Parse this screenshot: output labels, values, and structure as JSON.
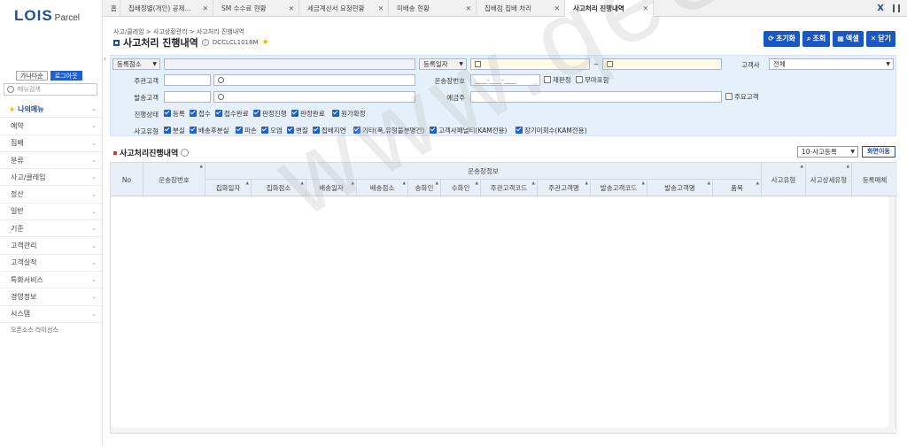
{
  "logo": {
    "brand": "LOIS",
    "sub": "Parcel"
  },
  "user": {
    "name_btn": "가나다순",
    "logout_btn": "로그아웃"
  },
  "menu_search": {
    "placeholder": "메뉴검색"
  },
  "menu": [
    {
      "label": "나의메뉴",
      "fav": true
    },
    {
      "label": "예약"
    },
    {
      "label": "집배"
    },
    {
      "label": "분류"
    },
    {
      "label": "사고/클레임"
    },
    {
      "label": "정산"
    },
    {
      "label": "일반"
    },
    {
      "label": "기준"
    },
    {
      "label": "고객관리"
    },
    {
      "label": "고객실적"
    },
    {
      "label": "특화서비스"
    },
    {
      "label": "경영정보"
    },
    {
      "label": "시스템"
    }
  ],
  "oss_label": "오픈소스 라이선스",
  "tabs": [
    {
      "label": "홈"
    },
    {
      "label": "집배정별(개인) 공제..."
    },
    {
      "label": "SM 수수료 현황"
    },
    {
      "label": "세금계산서 요청현황"
    },
    {
      "label": "미배송 현황"
    },
    {
      "label": "집배점 집배 처리"
    },
    {
      "label": "사고처리 진행내역",
      "active": true
    }
  ],
  "breadcrumb": "사고/클레임 > 사고상황관리 > 사고처리 진행내역",
  "page": {
    "title": "사고처리 진행내역",
    "code": "DCCLCL1018M"
  },
  "actions": {
    "reset": "초기화",
    "search": "조회",
    "excel": "엑셀",
    "close": "닫기"
  },
  "filter": {
    "reg_place_sel": "등록점소",
    "reg_date_sel": "등록일자",
    "date_sep": "~",
    "customer_company_label": "고객사",
    "customer_company_value": "전체",
    "main_customer_label": "주관고객",
    "waybill_label": "운송장번호",
    "waybill_placeholder": "____-____-____",
    "rejudge": "재판정",
    "noauth": "무마포함",
    "ship_customer_label": "발송고객",
    "depositor_label": "예금주",
    "main_customer_chk": "주요고객",
    "status_label": "진행상태",
    "statuses": [
      "등록",
      "접수",
      "접수완료",
      "판정진행",
      "판정완료",
      "원가확정"
    ],
    "type_label": "사고유형",
    "types": [
      "분실",
      "배송후분실",
      "파손",
      "오염",
      "변질",
      "집배지연",
      "기타(폭,유형불분명건)",
      "고객사패널티(KAM전용)",
      "장기미회수(KAM전용)"
    ]
  },
  "grid": {
    "title": "사고처리진행내역",
    "page_size": "10-사고등록",
    "move_btn": "화면이동",
    "group_header": "운송장정보",
    "columns": [
      "No",
      "운송장번호",
      "집화일자",
      "집화점소",
      "배송일자",
      "배송점소",
      "송화인",
      "수화인",
      "주관고객코드",
      "주관고객명",
      "발송고객코드",
      "발송고객명",
      "품목",
      "사고유형",
      "사고상세유형",
      "등록매체"
    ]
  },
  "watermark": "www.qee.kr",
  "colors": {
    "accent": "#1a56c4",
    "filter_bg": "#e6f0fb",
    "header_bg": "#e9eff7"
  }
}
